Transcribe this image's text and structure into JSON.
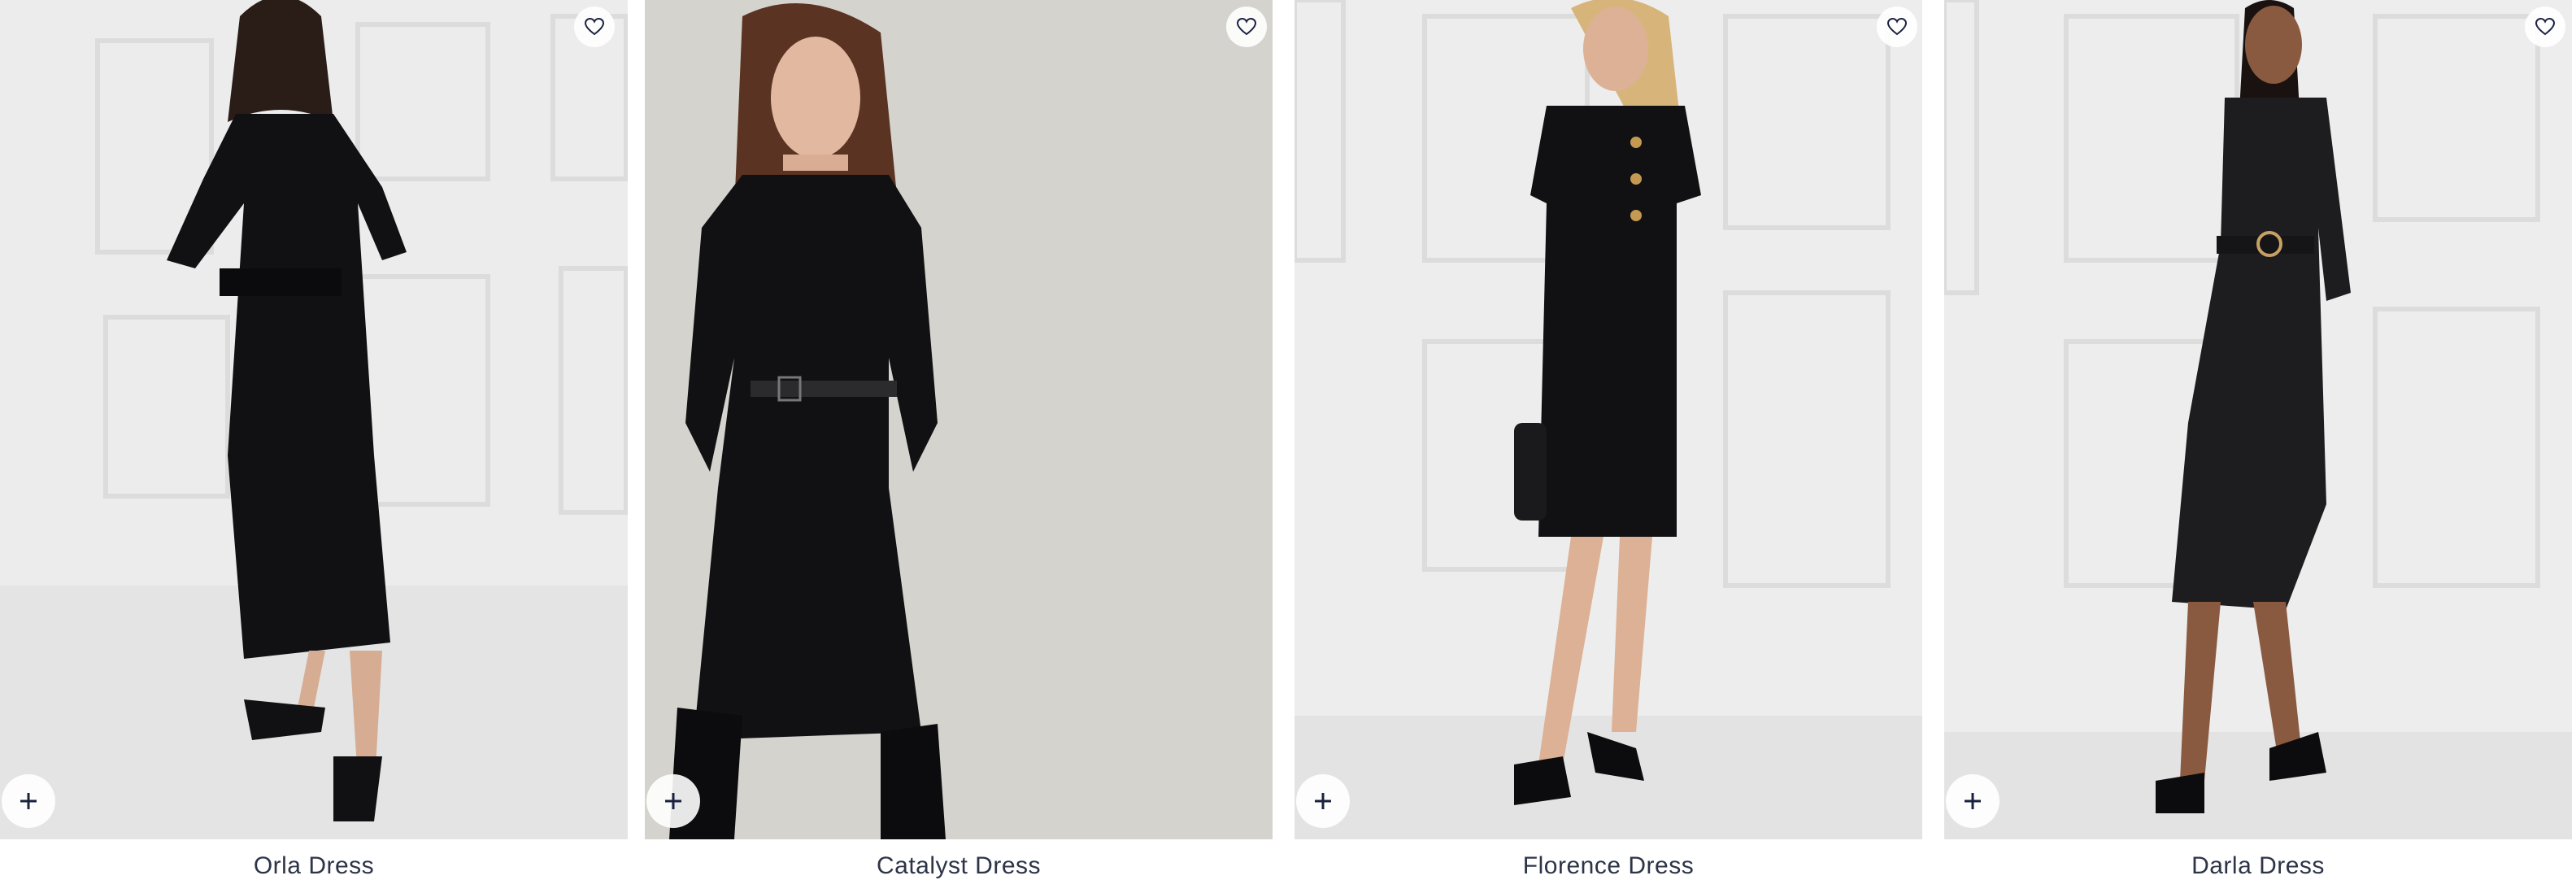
{
  "products": [
    {
      "name": "Orla Dress",
      "favorite_icon": "heart-outline-icon",
      "quick_add_icon": "plus-icon"
    },
    {
      "name": "Catalyst Dress",
      "favorite_icon": "heart-outline-icon",
      "quick_add_icon": "plus-icon"
    },
    {
      "name": "Florence Dress",
      "favorite_icon": "heart-outline-icon",
      "quick_add_icon": "plus-icon"
    },
    {
      "name": "Darla Dress",
      "favorite_icon": "heart-outline-icon",
      "quick_add_icon": "plus-icon"
    }
  ],
  "colors": {
    "text": "#2c3447",
    "icon": "#1b2240",
    "dress": "#111114",
    "photo_bg_light": "#ededed",
    "photo_bg_warm": "#d9d7d3"
  }
}
